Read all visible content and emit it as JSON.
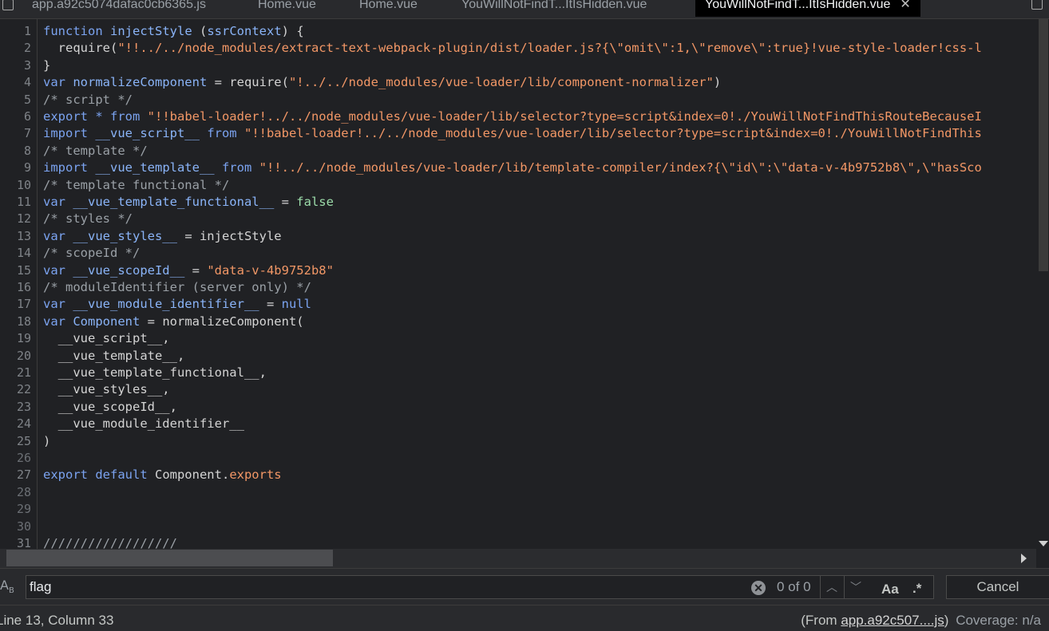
{
  "tabs": [
    {
      "label": "app.a92c5074dafac0cb6365.js",
      "active": false
    },
    {
      "label": "Home.vue",
      "active": false
    },
    {
      "label": "Home.vue",
      "active": false
    },
    {
      "label": "YouWillNotFindT...ItIsHidden.vue",
      "active": false
    },
    {
      "label": "YouWillNotFindT...ItIsHidden.vue",
      "active": true
    }
  ],
  "tab_close_glyph": "✕",
  "code_lines": [
    {
      "n": "1",
      "parts": [
        [
          "kw",
          "function "
        ],
        [
          "def",
          "injectStyle"
        ],
        [
          "fn",
          " ("
        ],
        [
          "def",
          "ssrContext"
        ],
        [
          "fn",
          ") {"
        ]
      ]
    },
    {
      "n": "2",
      "parts": [
        [
          "fn",
          "  require("
        ],
        [
          "str",
          "\"!!../../node_modules/extract-text-webpack-plugin/dist/loader.js?{\\\"omit\\\":1,\\\"remove\\\":true}!vue-style-loader!css-l"
        ]
      ]
    },
    {
      "n": "3",
      "parts": [
        [
          "fn",
          "}"
        ]
      ]
    },
    {
      "n": "4",
      "parts": [
        [
          "kw",
          "var "
        ],
        [
          "def",
          "normalizeComponent"
        ],
        [
          "fn",
          " = require("
        ],
        [
          "str",
          "\"!../../node_modules/vue-loader/lib/component-normalizer\""
        ],
        [
          "fn",
          ")"
        ]
      ]
    },
    {
      "n": "5",
      "parts": [
        [
          "cm",
          "/* script */"
        ]
      ]
    },
    {
      "n": "6",
      "parts": [
        [
          "kw",
          "export * from "
        ],
        [
          "str",
          "\"!!babel-loader!../../node_modules/vue-loader/lib/selector?type=script&index=0!./YouWillNotFindThisRouteBecauseI"
        ]
      ]
    },
    {
      "n": "7",
      "parts": [
        [
          "kw",
          "import "
        ],
        [
          "def",
          "__vue_script__"
        ],
        [
          "kw",
          " from "
        ],
        [
          "str",
          "\"!!babel-loader!../../node_modules/vue-loader/lib/selector?type=script&index=0!./YouWillNotFindThis"
        ]
      ]
    },
    {
      "n": "8",
      "parts": [
        [
          "cm",
          "/* template */"
        ]
      ]
    },
    {
      "n": "9",
      "parts": [
        [
          "kw",
          "import "
        ],
        [
          "def",
          "__vue_template__"
        ],
        [
          "kw",
          " from "
        ],
        [
          "str",
          "\"!!../../node_modules/vue-loader/lib/template-compiler/index?{\\\"id\\\":\\\"data-v-4b9752b8\\\",\\\"hasSco"
        ]
      ]
    },
    {
      "n": "10",
      "parts": [
        [
          "cm",
          "/* template functional */"
        ]
      ]
    },
    {
      "n": "11",
      "parts": [
        [
          "kw",
          "var "
        ],
        [
          "def",
          "__vue_template_functional__"
        ],
        [
          "fn",
          " = "
        ],
        [
          "lit",
          "false"
        ]
      ]
    },
    {
      "n": "12",
      "parts": [
        [
          "cm",
          "/* styles */"
        ]
      ]
    },
    {
      "n": "13",
      "parts": [
        [
          "kw",
          "var "
        ],
        [
          "def",
          "__vue_styles__"
        ],
        [
          "fn",
          " = injectStyle"
        ]
      ]
    },
    {
      "n": "14",
      "parts": [
        [
          "cm",
          "/* scopeId */"
        ]
      ]
    },
    {
      "n": "15",
      "parts": [
        [
          "kw",
          "var "
        ],
        [
          "def",
          "__vue_scopeId__"
        ],
        [
          "fn",
          " = "
        ],
        [
          "str",
          "\"data-v-4b9752b8\""
        ]
      ]
    },
    {
      "n": "16",
      "parts": [
        [
          "cm",
          "/* moduleIdentifier (server only) */"
        ]
      ]
    },
    {
      "n": "17",
      "parts": [
        [
          "kw",
          "var "
        ],
        [
          "def",
          "__vue_module_identifier__"
        ],
        [
          "fn",
          " = "
        ],
        [
          "kw",
          "null"
        ]
      ]
    },
    {
      "n": "18",
      "parts": [
        [
          "kw",
          "var "
        ],
        [
          "def",
          "Component"
        ],
        [
          "fn",
          " = normalizeComponent("
        ]
      ]
    },
    {
      "n": "19",
      "parts": [
        [
          "fn",
          "  __vue_script__,"
        ]
      ]
    },
    {
      "n": "20",
      "parts": [
        [
          "fn",
          "  __vue_template__,"
        ]
      ]
    },
    {
      "n": "21",
      "parts": [
        [
          "fn",
          "  __vue_template_functional__,"
        ]
      ]
    },
    {
      "n": "22",
      "parts": [
        [
          "fn",
          "  __vue_styles__,"
        ]
      ]
    },
    {
      "n": "23",
      "parts": [
        [
          "fn",
          "  __vue_scopeId__,"
        ]
      ]
    },
    {
      "n": "24",
      "parts": [
        [
          "fn",
          "  __vue_module_identifier__"
        ]
      ]
    },
    {
      "n": "25",
      "parts": [
        [
          "fn",
          ")"
        ]
      ]
    },
    {
      "n": "26",
      "parts": []
    },
    {
      "n": "27",
      "parts": [
        [
          "kw",
          "export default "
        ],
        [
          "fn",
          "Component."
        ],
        [
          "str",
          "exports"
        ]
      ]
    },
    {
      "n": "28",
      "parts": []
    },
    {
      "n": "29",
      "parts": []
    },
    {
      "n": "30",
      "parts": []
    },
    {
      "n": "31",
      "parts": [
        [
          "cm",
          "//////////////////"
        ]
      ]
    }
  ],
  "search": {
    "replace_toggle": "A",
    "replace_toggle_sub": "B",
    "value": "flag",
    "clear_glyph": "✕",
    "match_count": "0 of 0",
    "prev_glyph": "︿",
    "next_glyph": "﹀",
    "case_label": "Aa",
    "regex_label": ".*",
    "cancel_label": "Cancel"
  },
  "status": {
    "cursor": "Line 13, Column 33",
    "from_prefix": "(From ",
    "from_link": "app.a92c507....js",
    "from_suffix": ")",
    "coverage": "Coverage: n/a"
  }
}
